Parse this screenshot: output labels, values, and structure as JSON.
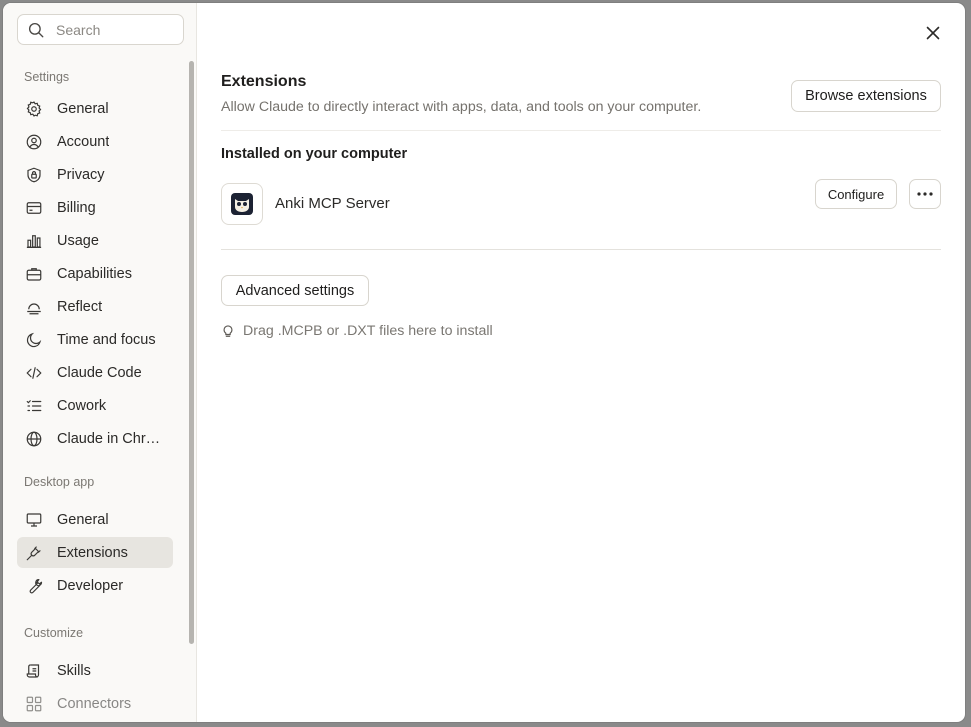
{
  "search": {
    "placeholder": "Search"
  },
  "sidebar": {
    "sections": [
      {
        "label": "Settings",
        "items": [
          {
            "label": "General",
            "icon": "gear-icon"
          },
          {
            "label": "Account",
            "icon": "user-circle-icon"
          },
          {
            "label": "Privacy",
            "icon": "shield-lock-icon"
          },
          {
            "label": "Billing",
            "icon": "credit-card-icon"
          },
          {
            "label": "Usage",
            "icon": "bar-chart-icon"
          },
          {
            "label": "Capabilities",
            "icon": "briefcase-icon"
          },
          {
            "label": "Reflect",
            "icon": "sunrise-icon"
          },
          {
            "label": "Time and focus",
            "icon": "moon-icon"
          },
          {
            "label": "Claude Code",
            "icon": "code-icon"
          },
          {
            "label": "Cowork",
            "icon": "checklist-icon"
          },
          {
            "label": "Claude in Chr…",
            "icon": "globe-icon"
          }
        ]
      },
      {
        "label": "Desktop app",
        "items": [
          {
            "label": "General",
            "icon": "monitor-icon"
          },
          {
            "label": "Extensions",
            "icon": "plug-icon",
            "active": true
          },
          {
            "label": "Developer",
            "icon": "wrench-icon"
          }
        ]
      },
      {
        "label": "Customize",
        "items": [
          {
            "label": "Skills",
            "icon": "scroll-icon"
          },
          {
            "label": "Connectors",
            "icon": "connectors-icon"
          }
        ]
      }
    ]
  },
  "main": {
    "title": "Extensions",
    "description": "Allow Claude to directly interact with apps, data, and tools on your computer.",
    "browse_label": "Browse extensions",
    "installed_title": "Installed on your computer",
    "extensions": [
      {
        "name": "Anki MCP Server",
        "configure_label": "Configure",
        "icon": "owl-icon"
      }
    ],
    "advanced_label": "Advanced settings",
    "drop_hint": "Drag .MCPB or .DXT files here to install"
  },
  "colors": {
    "accent_active_bg": "#e7e5e0",
    "sidebar_bg": "#faf9f7",
    "text_primary": "#1f1e1d",
    "text_muted": "#75726d"
  }
}
